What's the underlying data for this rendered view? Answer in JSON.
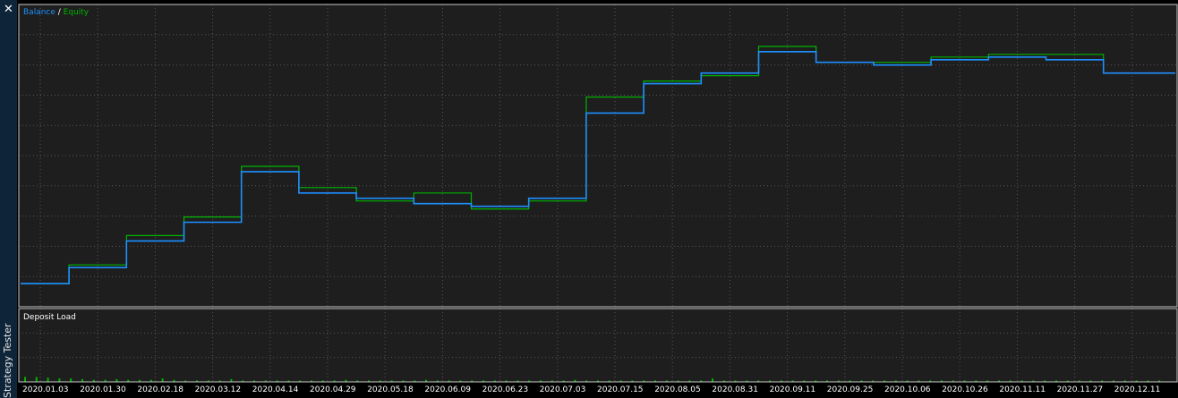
{
  "window": {
    "close_label": "✕",
    "side_tab_label": "Strategy Tester"
  },
  "colors": {
    "background": "#000000",
    "plot_bg": "#1e1e1e",
    "frame": "#c8c8c8",
    "grid": "#555555",
    "balance": "#1e90ff",
    "equity": "#00b400",
    "deposit_load": "#00b400",
    "axis_text": "#ffffff",
    "sidebar": "#0e2438"
  },
  "chart_data": [
    {
      "type": "line",
      "panel": "main",
      "legend_parts": [
        "Balance",
        " / ",
        "Equity"
      ],
      "grid": true,
      "x": [
        "2020.01.03",
        "2020.01.30",
        "2020.02.18",
        "2020.03.12",
        "2020.04.14",
        "2020.04.29",
        "2020.05.18",
        "2020.06.09",
        "2020.06.23",
        "2020.07.03",
        "2020.07.15",
        "2020.08.05",
        "2020.08.31",
        "2020.09.11",
        "2020.09.25",
        "2020.10.06",
        "2020.10.26",
        "2020.11.11",
        "2020.11.27",
        "2020.12.11"
      ],
      "ylim": [
        0,
        100
      ],
      "series": [
        {
          "name": "Balance",
          "values": [
            4,
            10,
            20,
            27,
            46,
            38,
            36,
            34,
            33,
            36,
            68,
            79,
            83,
            91,
            87,
            86,
            88,
            89,
            88,
            83
          ]
        },
        {
          "name": "Equity",
          "values": [
            4,
            11,
            22,
            29,
            48,
            40,
            35,
            38,
            32,
            35,
            74,
            80,
            82,
            93,
            87,
            87,
            89,
            90,
            90,
            83
          ]
        }
      ]
    },
    {
      "type": "bar",
      "panel": "deposit_load",
      "title": "Deposit Load",
      "ylim": [
        0,
        100
      ],
      "values": [
        7,
        7,
        6,
        5,
        5,
        4,
        3,
        3,
        4,
        3,
        3,
        3,
        5,
        3,
        2,
        2,
        2,
        2,
        4,
        2,
        2,
        2,
        2,
        2,
        2,
        2,
        2,
        2,
        3,
        2,
        2,
        2,
        2,
        2,
        2,
        3,
        2,
        2,
        2,
        2,
        2,
        2,
        2,
        2,
        2,
        2,
        2,
        2,
        3,
        2,
        2,
        2,
        2,
        2,
        2,
        2,
        2,
        2,
        2,
        2,
        5,
        2,
        2,
        2,
        2,
        2,
        2,
        2,
        2,
        2,
        2,
        2,
        2,
        2,
        2,
        2,
        2,
        2,
        2,
        2,
        2,
        2,
        2,
        2,
        2,
        2,
        2,
        2,
        2,
        2,
        2,
        2,
        2,
        2,
        2,
        2,
        2,
        2,
        2,
        2
      ]
    }
  ]
}
